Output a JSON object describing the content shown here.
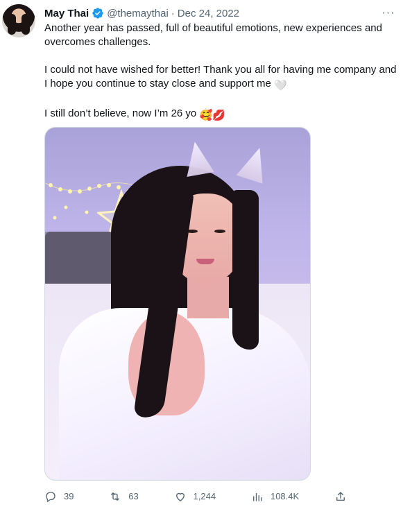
{
  "author": {
    "display_name": "May Thai",
    "handle": "@themaythai",
    "separator": "·",
    "date": "Dec 24, 2022",
    "verified_color": "#1d9bf0"
  },
  "more_label": "···",
  "tweet": {
    "line1": "Another year has passed, full of beautiful emotions, new experiences and overcomes challenges.",
    "line2": "I could not have wished for better! Thank you all for having me company and I hope you continue to stay close and support me",
    "line2_emoji": "🤍",
    "line3": "I still don’t believe, now I’m 26 yo",
    "line3_emoji": "🥰💋"
  },
  "metrics": {
    "replies": "39",
    "retweets": "63",
    "likes": "1,244",
    "views": "108.4K"
  },
  "icons": {
    "reply": "reply-icon",
    "retweet": "retweet-icon",
    "like": "like-icon",
    "views": "views-icon",
    "share": "share-icon",
    "verified": "verified-badge-icon",
    "more": "more-icon"
  }
}
